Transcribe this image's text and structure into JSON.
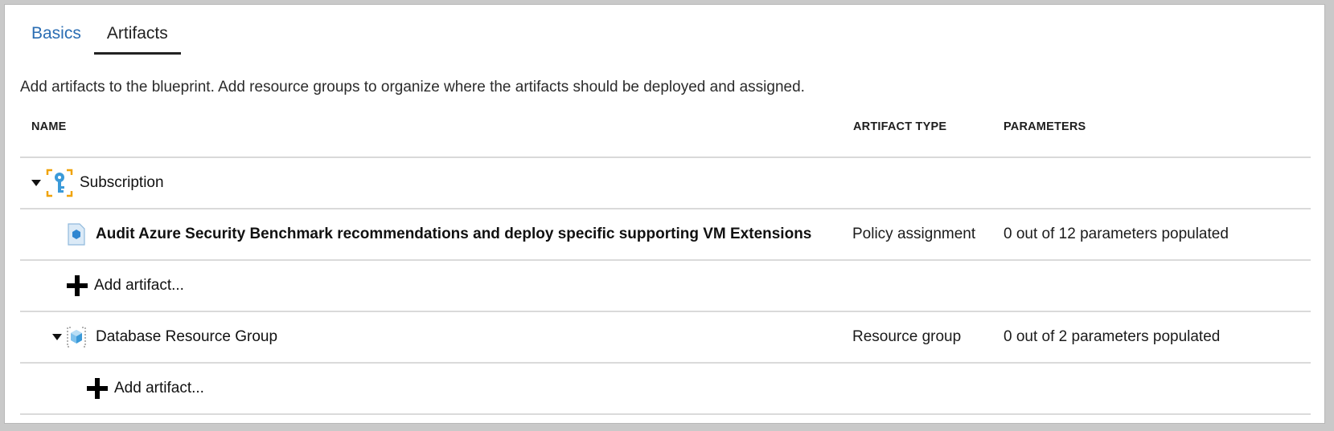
{
  "tabs": [
    {
      "label": "Basics"
    },
    {
      "label": "Artifacts"
    }
  ],
  "intro": "Add artifacts to the blueprint. Add resource groups to organize where the artifacts should be deployed and assigned.",
  "columns": {
    "name": "NAME",
    "type": "ARTIFACT TYPE",
    "params": "PARAMETERS"
  },
  "rows": {
    "subscription": {
      "name": "Subscription",
      "icon": "key-icon"
    },
    "policy": {
      "name": "Audit Azure Security Benchmark recommendations and deploy specific supporting VM Extensions",
      "type": "Policy assignment",
      "params": "0 out of 12 parameters populated",
      "icon": "policy-icon"
    },
    "add_sub": {
      "label": "Add artifact..."
    },
    "db_group": {
      "name": "Database Resource Group",
      "type": "Resource group",
      "params": "0 out of 2 parameters populated",
      "icon": "resource-group-icon"
    },
    "add_db": {
      "label": "Add artifact..."
    }
  },
  "colors": {
    "tab_link": "#2a6db3",
    "azure_blue": "#3b9ad9",
    "bracket_orange": "#f0a30a"
  }
}
